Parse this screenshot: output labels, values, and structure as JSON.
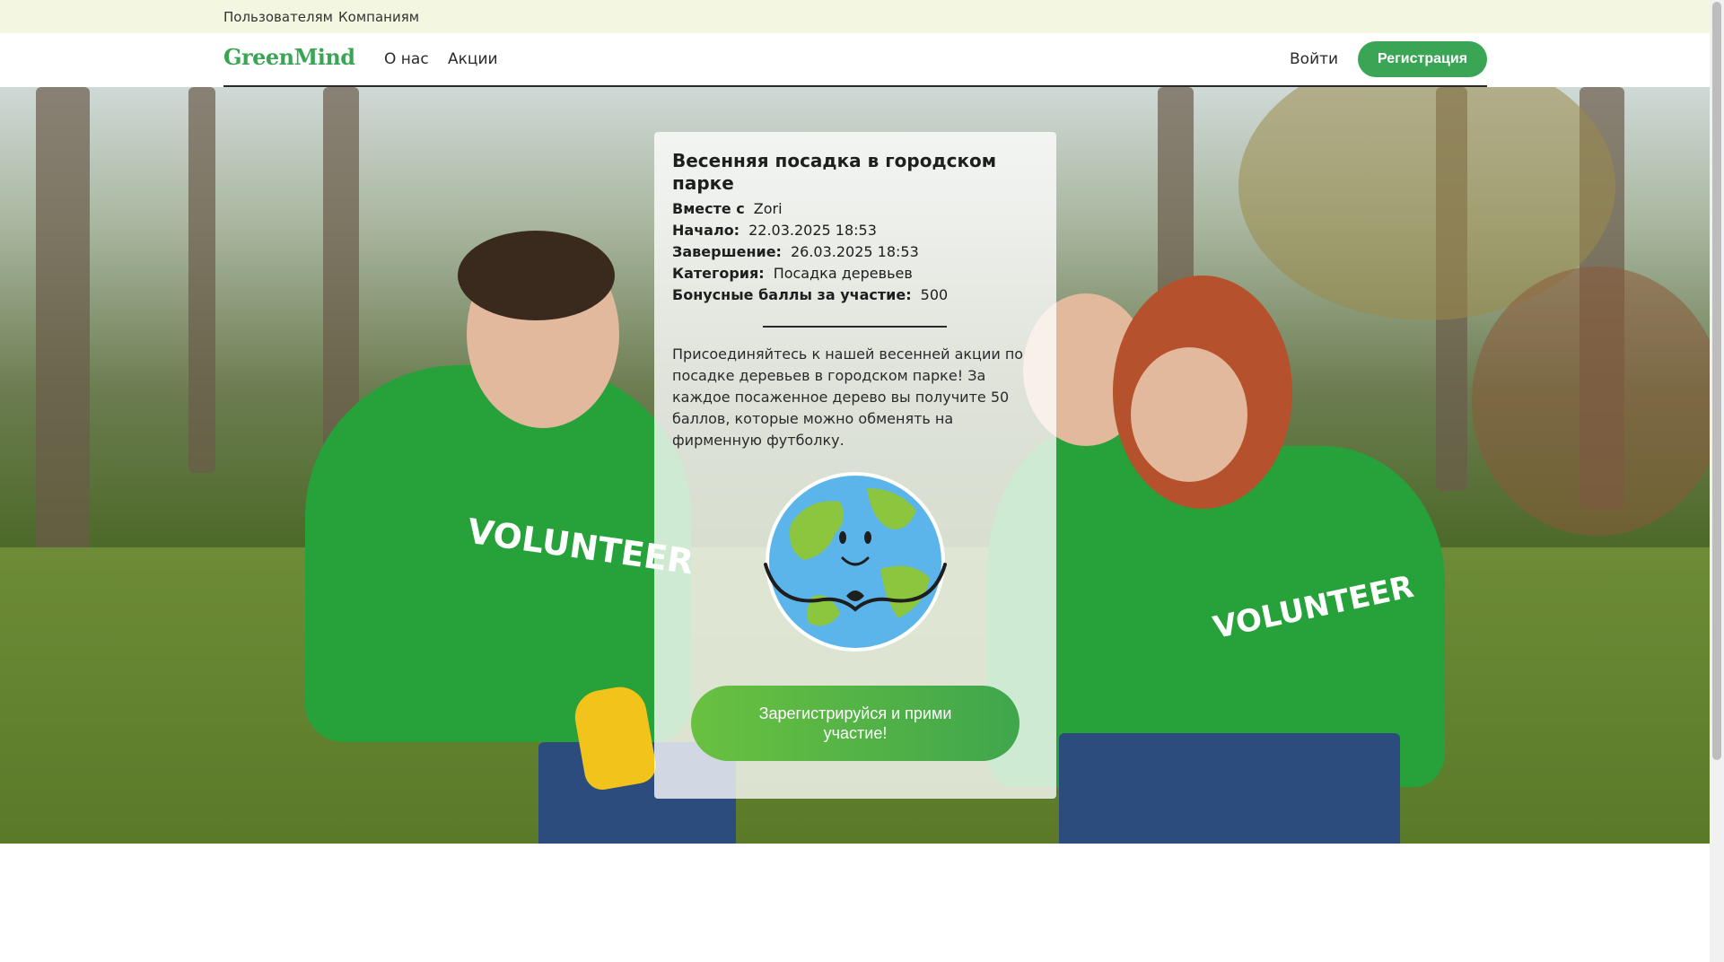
{
  "topbar": {
    "users": "Пользователям",
    "companies": "Компаниям"
  },
  "nav": {
    "logo": "GreenMind",
    "about": "О нас",
    "actions": "Акции",
    "login": "Войти",
    "register": "Регистрация"
  },
  "event": {
    "title": "Весенняя посадка в городском парке",
    "meta": [
      {
        "key": "Вместе с",
        "value": "Zori"
      },
      {
        "key": "Начало:",
        "value": "22.03.2025 18:53"
      },
      {
        "key": "Завершение:",
        "value": "26.03.2025 18:53"
      },
      {
        "key": "Категория:",
        "value": "Посадка деревьев"
      },
      {
        "key": "Бонусные баллы за участие:",
        "value": "500"
      }
    ],
    "description": "Присоединяйтесь к нашей весенней акции по посадке деревьев в городском парке! За каждое посаженное дерево вы получите 50 баллов, которые можно обменять на фирменную футболку.",
    "cta": "Зарегистрируйся и прими участие!"
  },
  "hero_text": {
    "volunteer": "VOLUNTEER"
  },
  "colors": {
    "accent": "#3aa655",
    "topbar_bg": "#f3f7e1"
  }
}
